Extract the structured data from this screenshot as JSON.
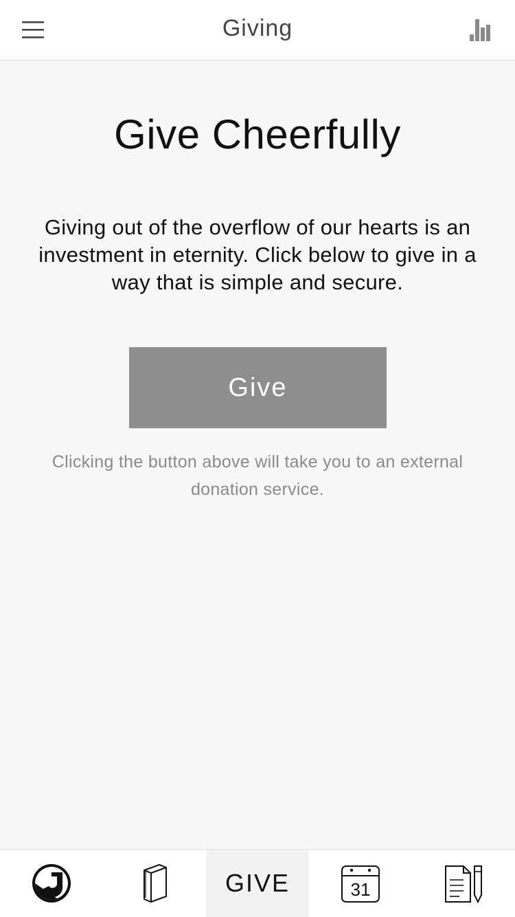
{
  "header": {
    "title": "Giving"
  },
  "main": {
    "title": "Give Cheerfully",
    "intro": "Giving out of the overflow of our hearts is an investment in eternity. Click below to give in a way that is simple and secure.",
    "give_button_label": "Give",
    "note": "Clicking the button above will take you to an external donation service."
  },
  "tabbar": {
    "tabs": [
      {
        "icon": "logo-icon",
        "label": ""
      },
      {
        "icon": "book-icon",
        "label": ""
      },
      {
        "icon": "",
        "label": "GIVE",
        "active": true
      },
      {
        "icon": "calendar-icon",
        "label": "31"
      },
      {
        "icon": "notes-icon",
        "label": ""
      }
    ]
  },
  "colors": {
    "header_bg": "#ffffff",
    "page_bg": "#f7f7f7",
    "button_bg": "#8e8e8e",
    "note_text": "#8a8a8a",
    "active_tab_bg": "#f2f2f2"
  }
}
